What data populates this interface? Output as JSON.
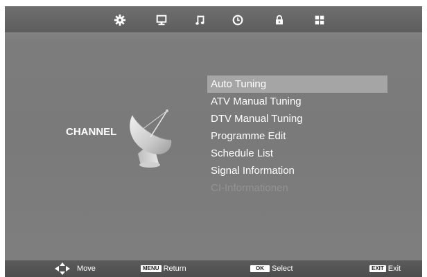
{
  "top_bar": {
    "icons": [
      "settings-gear-icon",
      "display-icon",
      "music-note-icon",
      "clock-icon",
      "lock-icon",
      "grid-icon"
    ],
    "active": "channel"
  },
  "section": {
    "title": "CHANNEL",
    "icon": "satellite-dish-icon"
  },
  "menu": {
    "items": [
      {
        "label": "Auto Tuning",
        "state": "selected"
      },
      {
        "label": "ATV Manual Tuning",
        "state": "normal"
      },
      {
        "label": "DTV Manual Tuning",
        "state": "normal"
      },
      {
        "label": "Programme Edit",
        "state": "normal"
      },
      {
        "label": "Schedule List",
        "state": "normal"
      },
      {
        "label": "Signal Information",
        "state": "normal"
      },
      {
        "label": "CI-Informationen",
        "state": "disabled"
      }
    ]
  },
  "bottom_bar": {
    "move": {
      "icon": "direction-arrows-icon",
      "label": "Move"
    },
    "return": {
      "key": "MENU",
      "label": "Return"
    },
    "select": {
      "key": "OK",
      "label": "Select"
    },
    "exit": {
      "key": "EXIT",
      "label": "Exit"
    }
  },
  "colors": {
    "background": "#7c7c7c",
    "selected_row": "#a5a5a5",
    "text": "#ffffff",
    "disabled_text": "#939393"
  }
}
